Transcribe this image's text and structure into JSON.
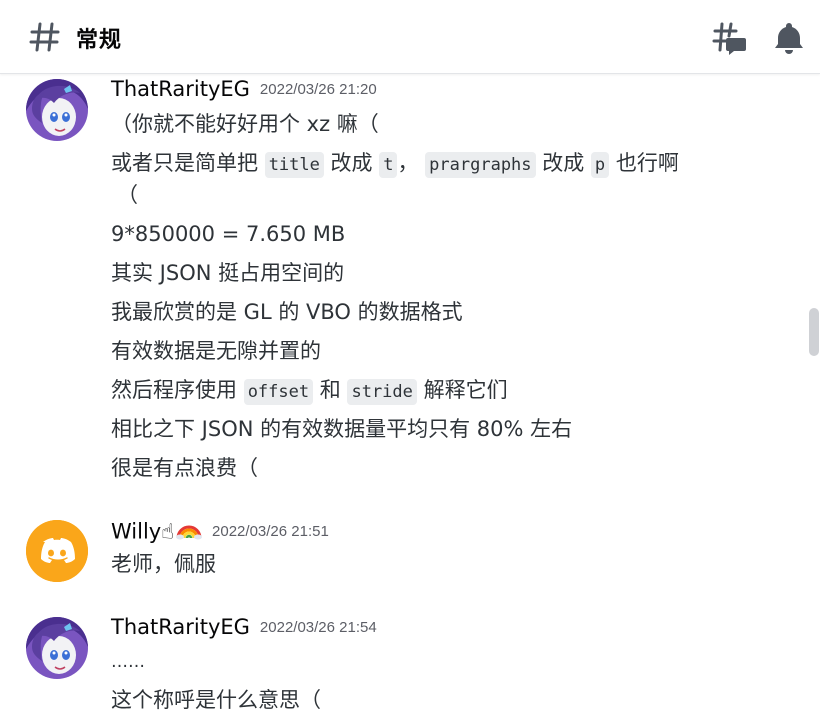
{
  "header": {
    "channel_name": "常规",
    "icons": [
      "hash-icon",
      "threads-icon",
      "bell-icon"
    ]
  },
  "messages": [
    {
      "author": "ThatRarityEG",
      "timestamp": "2022/03/26 21:20",
      "avatar": "rarity-avatar",
      "lines": [
        "（你就不能好好用个 xz 嘛（",
        {
          "parts": [
            "或者只是简单把 ",
            {
              "code": "title"
            },
            " 改成 ",
            {
              "code": "t"
            },
            "， ",
            {
              "code": "prargraphs"
            },
            " 改成 ",
            {
              "code": "p"
            },
            " 也行啊"
          ]
        },
        "（",
        "9*850000 = 7.650 MB",
        "其实 JSON 挺占用空间的",
        "我最欣赏的是 GL 的 VBO 的数据格式",
        "有效数据是无隙并置的",
        {
          "parts": [
            "然后程序使用 ",
            {
              "code": "offset"
            },
            " 和 ",
            {
              "code": "stride"
            },
            " 解释它们"
          ]
        },
        "相比之下 JSON 的有效数据量平均只有 80% 左右",
        "很是有点浪费（"
      ]
    },
    {
      "author": "Willy☝",
      "author_emoji": "rainbow-icon",
      "timestamp": "2022/03/26 21:51",
      "avatar": "discord-avatar",
      "avatar_color": "#faa61a",
      "lines": [
        "老师，佩服"
      ]
    },
    {
      "author": "ThatRarityEG",
      "timestamp": "2022/03/26 21:54",
      "avatar": "rarity-avatar",
      "lines": [
        "……",
        "这个称呼是什么意思（"
      ]
    }
  ],
  "colors": {
    "text": "#2e3338",
    "muted": "#5c5e66",
    "code_bg": "#ebedef",
    "discord_orange": "#faa61a",
    "rarity_hair": "#5b3fa0"
  }
}
